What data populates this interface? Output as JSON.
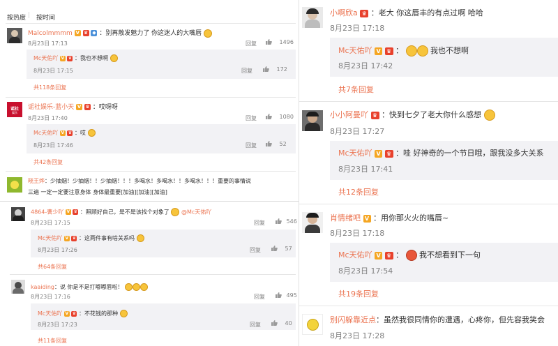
{
  "left_top": {
    "tabs": [
      "按热度",
      "按时间"
    ],
    "comments": [
      {
        "user": "Malcolmmmm",
        "text": "：别再散发魅力了 你这迷人的大嘴唇",
        "date": "8月23日 17:13",
        "reply_label": "回复",
        "likes": "1496",
        "reply": {
          "user": "Mc天佑吖",
          "text": "：我也不想啊",
          "date": "8月23日 17:15",
          "reply_label": "回复",
          "likes": "172"
        },
        "more": "共118条回复"
      },
      {
        "user": "谣社娱乐-蓝小天",
        "text": "：哎呀呀",
        "date": "8月23日 17:40",
        "reply_label": "回复",
        "likes": "1080",
        "reply": {
          "user": "Mc天佑吖",
          "text": "：哎",
          "date": "8月23日 17:46",
          "reply_label": "回复",
          "likes": "52"
        },
        "more": "共42条回复"
      },
      {
        "user": "晓王烨",
        "text": "：少抽烟！少抽烟！！少抽烟！！！多喝水！多喝水！！多喝水！！！重要的事情说",
        "text2": "三遍 一定一定要注意身体 身体最重要[加油][加油][加油]"
      }
    ]
  },
  "left_bottom": {
    "comments": [
      {
        "user": "4864-曹少吖",
        "text": "：照顾好自己，是不是该找个对象了",
        "mention": "@Mc天佑吖",
        "date": "8月23日 17:15",
        "reply_label": "回复",
        "likes": "546",
        "reply": {
          "user": "Mc天佑吖",
          "text": "：这两件事有啥关系吗",
          "date": "8月23日 17:26",
          "reply_label": "回复",
          "likes": "57"
        },
        "more": "共64条回复"
      },
      {
        "user": "kaaiding",
        "text": "：说 你是不是打嘟嘟唇啦！",
        "date": "8月23日 17:16",
        "reply_label": "回复",
        "likes": "495",
        "reply": {
          "user": "Mc天佑吖",
          "text": "：不花钱的那种",
          "date": "8月23日 17:23",
          "reply_label": "回复",
          "likes": "40"
        },
        "more": "共11条回复"
      }
    ]
  },
  "right": {
    "comments": [
      {
        "user": "小啊欣a",
        "text": "：老大 你这唇丰的有点过啊 哈哈",
        "date": "8月23日 17:18",
        "reply": {
          "user": "Mc天佑吖",
          "text": "我也不想啊",
          "date": "8月23日 17:42"
        },
        "more": "共7条回复"
      },
      {
        "user": "小小阿曼吖",
        "text": "：快到七夕了老大你什么感想",
        "date": "8月23日 17:27",
        "reply": {
          "user": "Mc天佑吖",
          "text": "：哇 好神奇的一个节日哦，跟我没多大关系",
          "date": "8月23日 17:41"
        },
        "more": "共12条回复"
      },
      {
        "user": "肖情绪吧",
        "text": "：用你那火火的嘴唇~",
        "date": "8月23日 17:18",
        "reply": {
          "user": "Mc天佑吖",
          "text": "我不想看到下一句",
          "date": "8月23日 17:54"
        },
        "more": "共19条回复"
      },
      {
        "user": "别闪躲靠近点",
        "text": "：虽然我很同情你的遭遇，心疼你，但先容我笑会",
        "date": "8月23日 17:28"
      }
    ]
  },
  "colors": {
    "accent": "#eb7350",
    "meta": "#808080",
    "reply_bg": "#f2f2f5",
    "badge_v": "#f5a623",
    "badge_red": "#e8412c"
  },
  "icons": [
    "thumb-up-icon",
    "v-badge-icon",
    "member-crown-icon",
    "emoji-icon",
    "avatar-icon"
  ]
}
